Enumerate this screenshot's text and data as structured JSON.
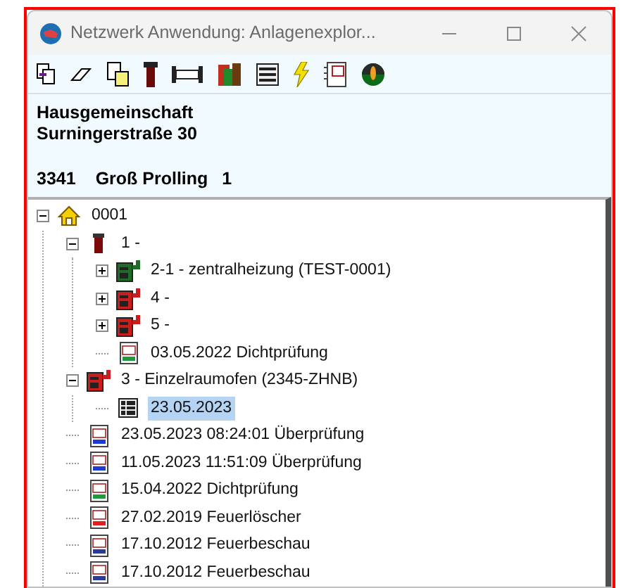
{
  "window": {
    "title": "Netzwerk Anwendung: Anlagenexplor..."
  },
  "info": {
    "line_1": "Hausgemeinschaft",
    "line_2": "Surningerstraße 30",
    "postcode": "3341",
    "place": "Groß Prolling",
    "number": "1"
  },
  "tree": [
    {
      "kind": "house",
      "label": "0001",
      "expanded": true,
      "selected": false,
      "children": [
        {
          "kind": "chimney",
          "label": "1 -",
          "expanded": true,
          "selected": false,
          "children": [
            {
              "kind": "boiler",
              "color": "#1f6b2a",
              "label": "2-1 - zentralheizung (TEST-0001)",
              "expanded": false,
              "selected": false
            },
            {
              "kind": "boiler",
              "color": "#c81e1e",
              "label": "4 -",
              "expanded": false,
              "selected": false
            },
            {
              "kind": "boiler",
              "color": "#c81e1e",
              "label": "5 -",
              "expanded": false,
              "selected": false
            },
            {
              "kind": "calendar",
              "color": "#1e9a3c",
              "label": "03.05.2022 Dichtprüfung",
              "selected": false
            }
          ]
        },
        {
          "kind": "boiler",
          "color": "#c81e1e",
          "label": "3 - Einzelraumofen (2345-ZHNB)",
          "expanded": true,
          "selected": false,
          "children": [
            {
              "kind": "list",
              "label": "23.05.2023",
              "selected": true
            }
          ]
        },
        {
          "kind": "calendar",
          "color": "#1e3ad0",
          "label": "23.05.2023 08:24:01 Überprüfung",
          "selected": false
        },
        {
          "kind": "calendar",
          "color": "#1e3ad0",
          "label": "11.05.2023 11:51:09 Überprüfung",
          "selected": false
        },
        {
          "kind": "calendar",
          "color": "#1e9a3c",
          "label": "15.04.2022 Dichtprüfung",
          "selected": false
        },
        {
          "kind": "calendar",
          "color": "#e02020",
          "label": "27.02.2019 Feuerlöscher",
          "selected": false
        },
        {
          "kind": "calendar",
          "color": "#2a3a9a",
          "label": "17.10.2012 Feuerbeschau",
          "selected": false
        },
        {
          "kind": "calendar",
          "color": "#2a3a9a",
          "label": "17.10.2012 Feuerbeschau",
          "selected": false
        }
      ]
    }
  ]
}
